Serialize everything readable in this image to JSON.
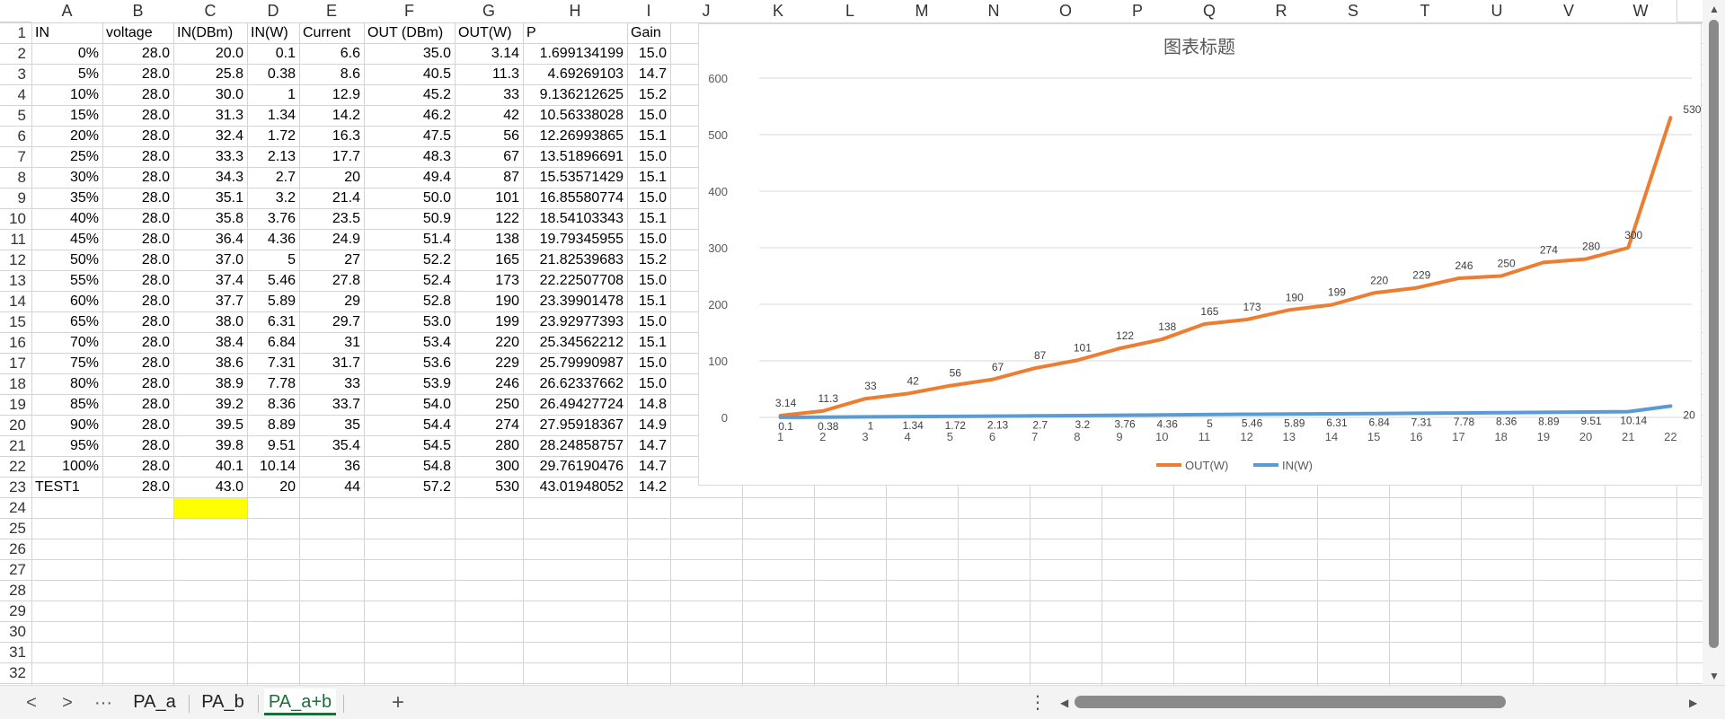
{
  "columns": [
    "A",
    "B",
    "C",
    "D",
    "E",
    "F",
    "G",
    "H",
    "I",
    "J",
    "K",
    "L",
    "M",
    "N",
    "O",
    "P",
    "Q",
    "R",
    "S",
    "T",
    "U",
    "V",
    "W"
  ],
  "rows": [
    "1",
    "2",
    "3",
    "4",
    "5",
    "6",
    "7",
    "8",
    "9",
    "10",
    "11",
    "12",
    "13",
    "14",
    "15",
    "16",
    "17",
    "18",
    "19",
    "20",
    "21",
    "22",
    "23",
    "24",
    "25",
    "26",
    "27",
    "28",
    "29",
    "30",
    "31",
    "32"
  ],
  "table": {
    "headers": [
      "IN",
      "voltage",
      "IN(DBm)",
      "IN(W)",
      "Current",
      "OUT (DBm)",
      "OUT(W)",
      "P",
      "Gain"
    ],
    "rows": [
      [
        "0%",
        "28.0",
        "20.0",
        "0.1",
        "6.6",
        "35.0",
        "3.14",
        "1.699134199",
        "15.0"
      ],
      [
        "5%",
        "28.0",
        "25.8",
        "0.38",
        "8.6",
        "40.5",
        "11.3",
        "4.69269103",
        "14.7"
      ],
      [
        "10%",
        "28.0",
        "30.0",
        "1",
        "12.9",
        "45.2",
        "33",
        "9.136212625",
        "15.2"
      ],
      [
        "15%",
        "28.0",
        "31.3",
        "1.34",
        "14.2",
        "46.2",
        "42",
        "10.56338028",
        "15.0"
      ],
      [
        "20%",
        "28.0",
        "32.4",
        "1.72",
        "16.3",
        "47.5",
        "56",
        "12.26993865",
        "15.1"
      ],
      [
        "25%",
        "28.0",
        "33.3",
        "2.13",
        "17.7",
        "48.3",
        "67",
        "13.51896691",
        "15.0"
      ],
      [
        "30%",
        "28.0",
        "34.3",
        "2.7",
        "20",
        "49.4",
        "87",
        "15.53571429",
        "15.1"
      ],
      [
        "35%",
        "28.0",
        "35.1",
        "3.2",
        "21.4",
        "50.0",
        "101",
        "16.85580774",
        "15.0"
      ],
      [
        "40%",
        "28.0",
        "35.8",
        "3.76",
        "23.5",
        "50.9",
        "122",
        "18.54103343",
        "15.1"
      ],
      [
        "45%",
        "28.0",
        "36.4",
        "4.36",
        "24.9",
        "51.4",
        "138",
        "19.79345955",
        "15.0"
      ],
      [
        "50%",
        "28.0",
        "37.0",
        "5",
        "27",
        "52.2",
        "165",
        "21.82539683",
        "15.2"
      ],
      [
        "55%",
        "28.0",
        "37.4",
        "5.46",
        "27.8",
        "52.4",
        "173",
        "22.22507708",
        "15.0"
      ],
      [
        "60%",
        "28.0",
        "37.7",
        "5.89",
        "29",
        "52.8",
        "190",
        "23.39901478",
        "15.1"
      ],
      [
        "65%",
        "28.0",
        "38.0",
        "6.31",
        "29.7",
        "53.0",
        "199",
        "23.92977393",
        "15.0"
      ],
      [
        "70%",
        "28.0",
        "38.4",
        "6.84",
        "31",
        "53.4",
        "220",
        "25.34562212",
        "15.1"
      ],
      [
        "75%",
        "28.0",
        "38.6",
        "7.31",
        "31.7",
        "53.6",
        "229",
        "25.79990987",
        "15.0"
      ],
      [
        "80%",
        "28.0",
        "38.9",
        "7.78",
        "33",
        "53.9",
        "246",
        "26.62337662",
        "15.0"
      ],
      [
        "85%",
        "28.0",
        "39.2",
        "8.36",
        "33.7",
        "54.0",
        "250",
        "26.49427724",
        "14.8"
      ],
      [
        "90%",
        "28.0",
        "39.5",
        "8.89",
        "35",
        "54.4",
        "274",
        "27.95918367",
        "14.9"
      ],
      [
        "95%",
        "28.0",
        "39.8",
        "9.51",
        "35.4",
        "54.5",
        "280",
        "28.24858757",
        "14.7"
      ],
      [
        "100%",
        "28.0",
        "40.1",
        "10.14",
        "36",
        "54.8",
        "300",
        "29.76190476",
        "14.7"
      ],
      [
        "TEST1",
        "28.0",
        "43.0",
        "20",
        "44",
        "57.2",
        "530",
        "43.01948052",
        "14.2"
      ]
    ],
    "highlight_fill": "#ffff00"
  },
  "chart_data": {
    "type": "line",
    "title": "图表标题",
    "xlabel": "",
    "ylabel": "",
    "categories": [
      "1",
      "2",
      "3",
      "4",
      "5",
      "6",
      "7",
      "8",
      "9",
      "10",
      "11",
      "12",
      "13",
      "14",
      "15",
      "16",
      "17",
      "18",
      "19",
      "20",
      "21",
      "22"
    ],
    "ylim": [
      0,
      600
    ],
    "yticks": [
      "0",
      "100",
      "200",
      "300",
      "400",
      "500",
      "600"
    ],
    "grid": true,
    "legend": "bottom",
    "series": [
      {
        "name": "OUT(W)",
        "color": "#ed7d31",
        "values": [
          3.14,
          11.3,
          33,
          42,
          56,
          67,
          87,
          101,
          122,
          138,
          165,
          173,
          190,
          199,
          220,
          229,
          246,
          250,
          274,
          280,
          300,
          530
        ],
        "labels": [
          "3.14",
          "11.3",
          "33",
          "42",
          "56",
          "67",
          "87",
          "101",
          "122",
          "138",
          "165",
          "173",
          "190",
          "199",
          "220",
          "229",
          "246",
          "250",
          "274",
          "280",
          "300",
          "530"
        ]
      },
      {
        "name": "IN(W)",
        "color": "#5b9bd5",
        "values": [
          0.1,
          0.38,
          1,
          1.34,
          1.72,
          2.13,
          2.7,
          3.2,
          3.76,
          4.36,
          5,
          5.46,
          5.89,
          6.31,
          6.84,
          7.31,
          7.78,
          8.36,
          8.89,
          9.51,
          10.14,
          20
        ],
        "labels": [
          "0.1",
          "0.38",
          "1",
          "1.34",
          "1.72",
          "2.13",
          "2.7",
          "3.2",
          "3.76",
          "4.36",
          "5",
          "5.46",
          "5.89",
          "6.31",
          "6.84",
          "7.31",
          "7.78",
          "8.36",
          "8.89",
          "9.51",
          "10.14",
          "20"
        ]
      }
    ]
  },
  "tabs": {
    "nav_prev": "<",
    "nav_next": ">",
    "more": "···",
    "items": [
      "PA_a",
      "PA_b",
      "PA_a+b"
    ],
    "active": "PA_a+b",
    "add": "+",
    "options": "⋮"
  }
}
